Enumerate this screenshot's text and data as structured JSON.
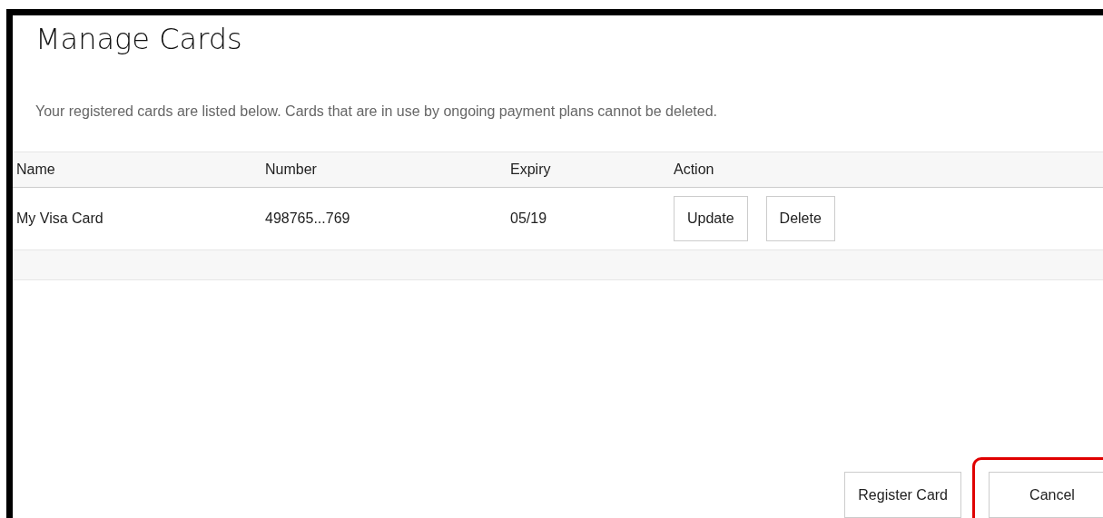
{
  "title": "Manage Cards",
  "description": "Your registered cards are listed below. Cards that are in use by ongoing payment plans cannot be deleted.",
  "table": {
    "columns": [
      "Name",
      "Number",
      "Expiry",
      "Action"
    ],
    "rows": [
      {
        "name": "My Visa Card",
        "number": "498765...769",
        "expiry": "05/19",
        "actions": [
          "Update",
          "Delete"
        ]
      }
    ]
  },
  "buttons": [
    {
      "label": "Register Card",
      "highlighted": false
    },
    {
      "label": "Cancel",
      "highlighted": true
    }
  ]
}
